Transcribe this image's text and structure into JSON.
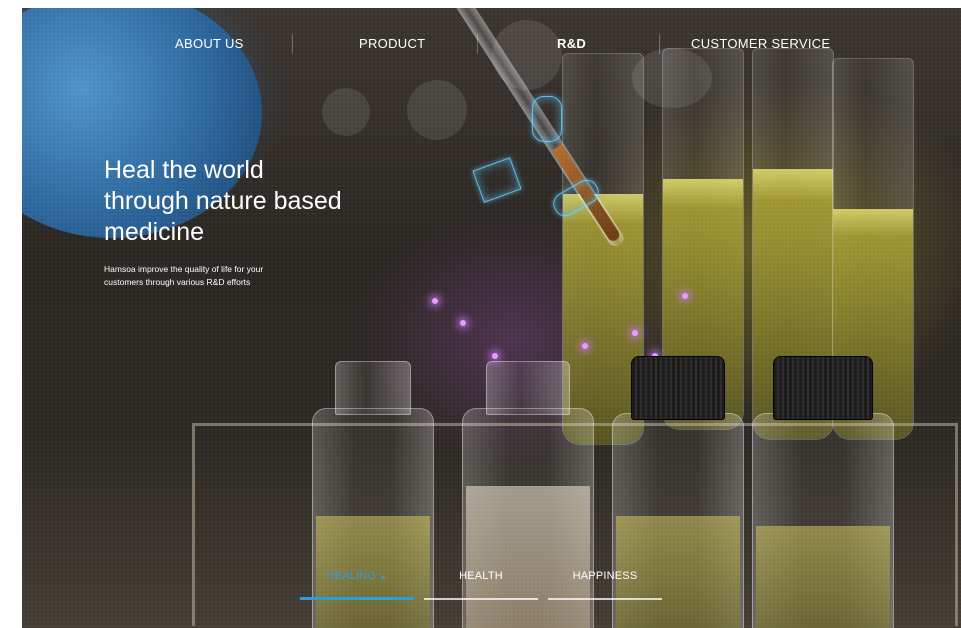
{
  "nav": {
    "items": [
      {
        "label": "ABOUT US"
      },
      {
        "label": "PRODUCT"
      },
      {
        "label": "R&D",
        "active": true
      },
      {
        "label": "CUSTOMER SERVICE"
      }
    ]
  },
  "hero": {
    "title_lines": [
      "Heal the world",
      "through nature based",
      "medicine"
    ],
    "subtitle_lines": [
      "Hamsoa improve the quality of life for your",
      "customers through various R&D efforts"
    ]
  },
  "tabs": [
    {
      "label": "HEALING",
      "indicator": "▲",
      "active": true
    },
    {
      "label": "HEALTH"
    },
    {
      "label": "HAPPINESS"
    }
  ],
  "colors": {
    "accent": "#2f9bd6",
    "text": "#ffffff"
  }
}
